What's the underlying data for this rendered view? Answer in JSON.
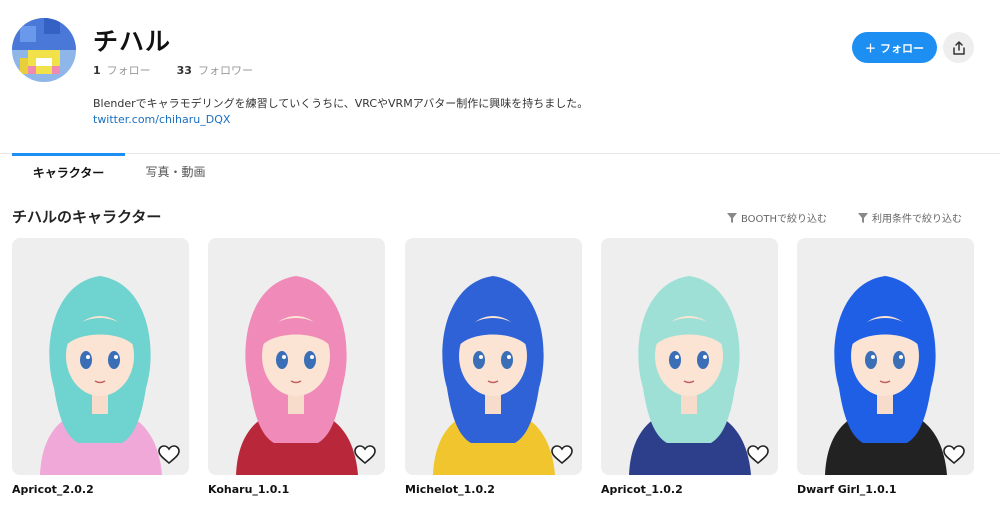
{
  "profile": {
    "name": "チハル",
    "following_count": "1",
    "following_label": "フォロー",
    "followers_count": "33",
    "followers_label": "フォロワー",
    "bio": "Blenderでキャラモデリングを練習していくうちに、VRCやVRMアバター制作に興味を持ちました。",
    "link": "twitter.com/chiharu_DQX",
    "follow_label": "フォロー",
    "follow_icon": "plus-icon",
    "share_icon": "share-icon"
  },
  "tabs": [
    {
      "label": "キャラクター",
      "active": true
    },
    {
      "label": "写真・動画",
      "active": false
    }
  ],
  "section": {
    "title": "チハルのキャラクター",
    "filters": [
      {
        "label": "BOOTHで絞り込む",
        "icon": "filter-icon"
      },
      {
        "label": "利用条件で絞り込む",
        "icon": "filter-icon"
      }
    ]
  },
  "characters": [
    {
      "name": "Apricot_2.0.2",
      "hair": "#6fd3cf",
      "outfit": "#f0a8d8"
    },
    {
      "name": "Koharu_1.0.1",
      "hair": "#f08ab8",
      "outfit": "#b8283a"
    },
    {
      "name": "Michelot_1.0.2",
      "hair": "#2e62d6",
      "outfit": "#f1c52e"
    },
    {
      "name": "Apricot_1.0.2",
      "hair": "#9fe0d6",
      "outfit": "#2d3f8a"
    },
    {
      "name": "Dwarf Girl_1.0.1",
      "hair": "#1f5fe6",
      "outfit": "#222222"
    }
  ],
  "colors": {
    "accent": "#1d8ff2",
    "link": "#1a6fc0"
  }
}
